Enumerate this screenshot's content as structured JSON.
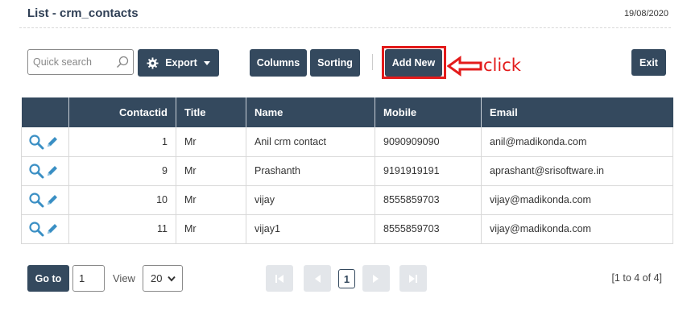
{
  "header": {
    "title": "List - crm_contacts",
    "date": "19/08/2020"
  },
  "toolbar": {
    "search_placeholder": "Quick search",
    "search_icon": "search-icon",
    "export_label": "Export",
    "export_icon": "gear-icon",
    "columns_label": "Columns",
    "sorting_label": "Sorting",
    "add_new_label": "Add New",
    "exit_label": "Exit",
    "annotation_text": "click",
    "annotation_color": "#e31b1b"
  },
  "table": {
    "columns": [
      "",
      "Contactid",
      "Title",
      "Name",
      "Mobile",
      "Email"
    ],
    "rows": [
      {
        "contactid": "1",
        "title": "Mr",
        "name": "Anil crm contact",
        "mobile": "9090909090",
        "email": "anil@madikonda.com"
      },
      {
        "contactid": "9",
        "title": "Mr",
        "name": "Prashanth",
        "mobile": "9191919191",
        "email": "aprashant@srisoftware.in"
      },
      {
        "contactid": "10",
        "title": "Mr",
        "name": "vijay",
        "mobile": "8555859703",
        "email": "vijay@madikonda.com"
      },
      {
        "contactid": "11",
        "title": "Mr",
        "name": "vijay1",
        "mobile": "8555859703",
        "email": "vijay@madikonda.com"
      }
    ],
    "row_icons": [
      "magnifier-icon",
      "pencil-icon"
    ]
  },
  "footer": {
    "goto_label": "Go to",
    "page_value": "1",
    "view_label": "View",
    "view_value": "20",
    "current_page": "1",
    "range_text": "[1 to 4 of 4]"
  },
  "colors": {
    "primary": "#34495e",
    "accent_icon": "#3a8fc4",
    "highlight": "#e31b1b"
  }
}
